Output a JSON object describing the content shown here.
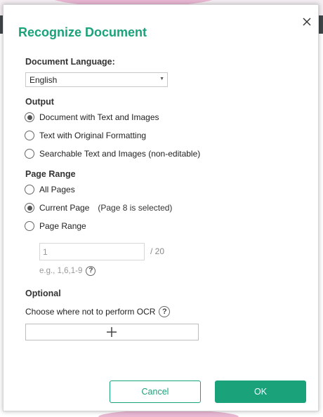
{
  "dialog": {
    "title": "Recognize Document",
    "close_icon": "close-icon"
  },
  "language": {
    "label": "Document Language:",
    "selected": "English"
  },
  "output": {
    "label": "Output",
    "options": [
      {
        "label": "Document with Text and Images",
        "checked": true
      },
      {
        "label": "Text with Original Formatting",
        "checked": false
      },
      {
        "label": "Searchable Text and Images (non-editable)",
        "checked": false
      }
    ]
  },
  "page_range": {
    "label": "Page Range",
    "options": [
      {
        "label": "All Pages",
        "checked": false,
        "note": ""
      },
      {
        "label": "Current Page",
        "checked": true,
        "note": "(Page 8 is selected)"
      },
      {
        "label": "Page Range",
        "checked": false,
        "note": ""
      }
    ],
    "input_placeholder": "1",
    "total": "/ 20",
    "hint": "e.g., 1,6,1-9"
  },
  "optional": {
    "label": "Optional",
    "description": "Choose where not to perform OCR",
    "add_icon": "plus-icon"
  },
  "buttons": {
    "cancel": "Cancel",
    "ok": "OK"
  },
  "colors": {
    "accent": "#1aa27a"
  }
}
